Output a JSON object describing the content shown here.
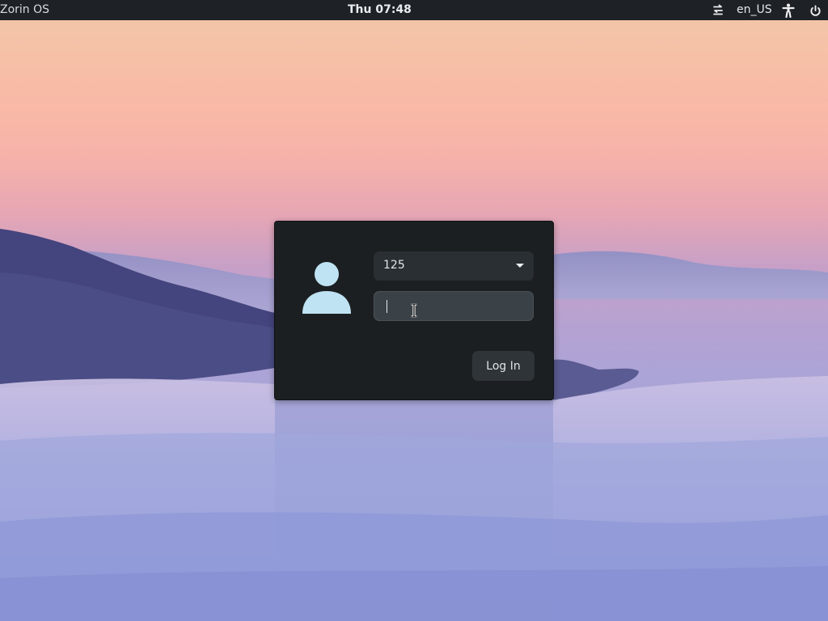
{
  "topbar": {
    "os_name": "Zorin OS",
    "clock": "Thu 07:48",
    "keyboard_layout": "en_US",
    "icons": [
      "network-settings-icon",
      "accessibility-icon",
      "power-icon"
    ]
  },
  "login": {
    "selected_user": "125",
    "password_value": "",
    "login_label": "Log In"
  },
  "colors": {
    "topbar_bg": "#1e2125",
    "dialog_bg": "#1c1f22",
    "avatar": "#bfe3f3",
    "input_bg": "#3b4247"
  }
}
